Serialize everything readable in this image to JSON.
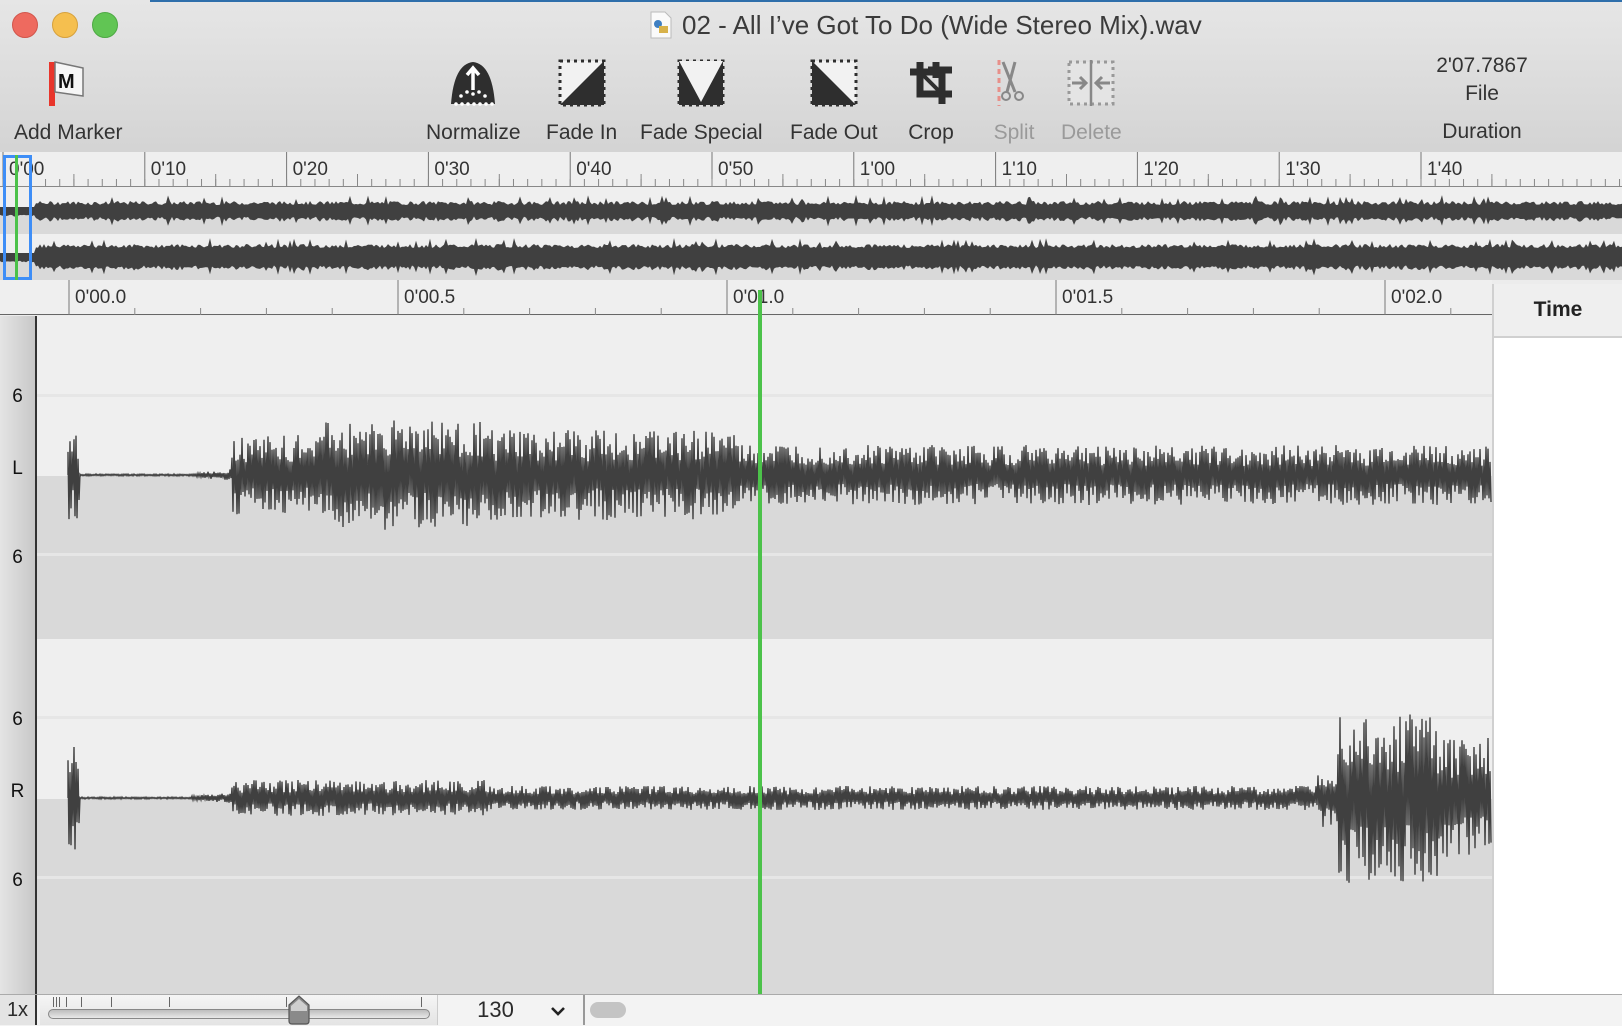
{
  "window": {
    "title": "02 - All I’ve Got To Do (Wide Stereo Mix).wav",
    "file_icon": "audio-file-icon"
  },
  "toolbar": {
    "tools": [
      {
        "id": "add-marker",
        "label": "Add Marker",
        "icon": "marker-flag-icon",
        "enabled": true
      },
      {
        "id": "normalize",
        "label": "Normalize",
        "icon": "normalize-icon",
        "enabled": true
      },
      {
        "id": "fade-in",
        "label": "Fade In",
        "icon": "fade-in-icon",
        "enabled": true
      },
      {
        "id": "fade-special",
        "label": "Fade Special",
        "icon": "fade-special-icon",
        "enabled": true
      },
      {
        "id": "fade-out",
        "label": "Fade Out",
        "icon": "fade-out-icon",
        "enabled": true
      },
      {
        "id": "crop",
        "label": "Crop",
        "icon": "crop-icon",
        "enabled": true
      },
      {
        "id": "split",
        "label": "Split",
        "icon": "scissors-icon",
        "enabled": false
      },
      {
        "id": "delete",
        "label": "Delete",
        "icon": "delete-gap-icon",
        "enabled": false
      }
    ],
    "duration": {
      "value": "2'07.7867",
      "mode": "File",
      "label": "Duration"
    }
  },
  "overview": {
    "ruler_labels": [
      "0'00",
      "0'10",
      "0'20",
      "0'30",
      "0'40",
      "0'50",
      "1'00",
      "1'10",
      "1'20",
      "1'30",
      "1'40"
    ]
  },
  "main": {
    "ruler_labels": [
      "0'00.0",
      "0'00.5",
      "0'01.0",
      "0'01.5",
      "0'02.0"
    ],
    "channels": [
      {
        "name": "L",
        "scale_top": "6",
        "scale_bottom": "6"
      },
      {
        "name": "R",
        "scale_top": "6",
        "scale_bottom": "6"
      }
    ],
    "playhead_time": "0'01.0"
  },
  "time_panel": {
    "header": "Time"
  },
  "bottombar": {
    "speed": "1x",
    "zoom_value": "130",
    "zoom_slider_fraction": 0.66
  },
  "colors": {
    "playhead": "#4cc24a",
    "viewport": "#3e8ef7",
    "waveform": "#404040"
  }
}
